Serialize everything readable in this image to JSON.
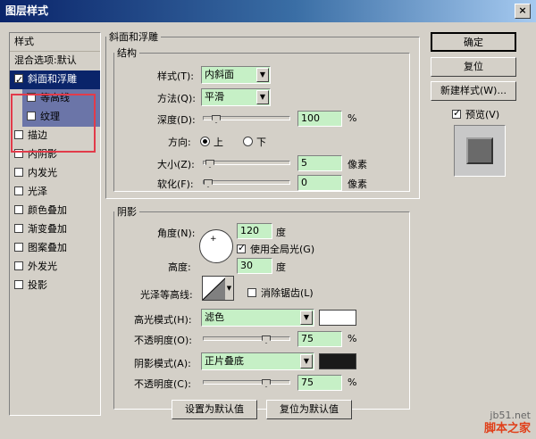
{
  "window": {
    "title": "图层样式",
    "close_glyph": "×"
  },
  "sidebar": {
    "header": "样式",
    "blend_options": "混合选项:默认",
    "items": [
      {
        "label": "斜面和浮雕",
        "checked": true
      },
      {
        "label": "等高线",
        "checked": false
      },
      {
        "label": "纹理",
        "checked": false
      },
      {
        "label": "描边",
        "checked": false
      },
      {
        "label": "内阴影",
        "checked": false
      },
      {
        "label": "内发光",
        "checked": false
      },
      {
        "label": "光泽",
        "checked": false
      },
      {
        "label": "颜色叠加",
        "checked": false
      },
      {
        "label": "渐变叠加",
        "checked": false
      },
      {
        "label": "图案叠加",
        "checked": false
      },
      {
        "label": "外发光",
        "checked": false
      },
      {
        "label": "投影",
        "checked": false
      }
    ],
    "highlight_color": "#e23b4a"
  },
  "bevel": {
    "title": "斜面和浮雕",
    "structure_title": "结构",
    "style_label": "样式(T):",
    "style_value": "内斜面",
    "technique_label": "方法(Q):",
    "technique_value": "平滑",
    "depth_label": "深度(D):",
    "depth_value": "100",
    "depth_unit": "%",
    "depth_level": 0.1,
    "direction_label": "方向:",
    "direction_up": "上",
    "direction_down": "下",
    "size_label": "大小(Z):",
    "size_value": "5",
    "size_unit": "像素",
    "size_level": 0.02,
    "soften_label": "软化(F):",
    "soften_value": "0",
    "soften_unit": "像素",
    "soften_level": 0.0
  },
  "shading": {
    "title": "阴影",
    "angle_label": "角度(N):",
    "angle_value": "120",
    "angle_unit": "度",
    "global_light_label": "使用全局光(G)",
    "global_light_checked": true,
    "altitude_label": "高度:",
    "altitude_value": "30",
    "altitude_unit": "度",
    "gloss_contour_label": "光泽等高线:",
    "anti_alias_label": "消除锯齿(L)",
    "highlight_mode_label": "高光模式(H):",
    "highlight_mode_value": "滤色",
    "highlight_color": "#ffffff",
    "highlight_opacity_label": "不透明度(O):",
    "highlight_opacity_value": "75",
    "highlight_opacity_unit": "%",
    "highlight_opacity_level": 0.75,
    "shadow_mode_label": "阴影模式(A):",
    "shadow_mode_value": "正片叠底",
    "shadow_color": "#1a1a1a",
    "shadow_opacity_label": "不透明度(C):",
    "shadow_opacity_value": "75",
    "shadow_opacity_unit": "%",
    "shadow_opacity_level": 0.75
  },
  "footer": {
    "make_default": "设置为默认值",
    "reset_default": "复位为默认值"
  },
  "actions": {
    "ok": "确定",
    "reset": "复位",
    "new_style": "新建样式(W)...",
    "preview_label": "预览(V)",
    "preview_checked": true
  },
  "watermark": {
    "site": "jb51.net",
    "brand": "脚本之家"
  }
}
